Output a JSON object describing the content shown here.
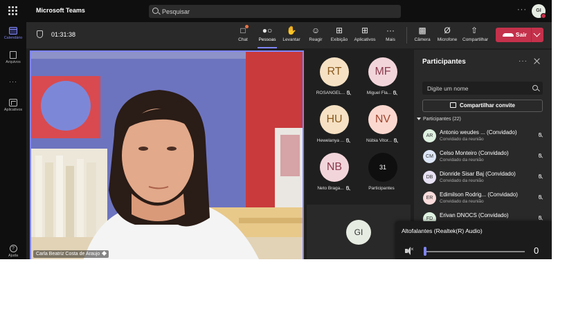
{
  "topbar": {
    "app_title": "Microsoft Teams",
    "search_placeholder": "Pesquisar",
    "more": "···",
    "user_initials": "GI"
  },
  "rail": {
    "items": [
      {
        "label": "Calendário",
        "icon": "calendar-icon",
        "active": true
      },
      {
        "label": "Arquivos",
        "icon": "file-icon"
      },
      {
        "label": "Aplicativos",
        "icon": "apps-icon"
      },
      {
        "label": "Ajuda",
        "icon": "help-icon"
      }
    ],
    "more": "···"
  },
  "meeting": {
    "timer": "01:31:38",
    "toolbar": [
      {
        "label": "Chat",
        "icon": "chat-icon"
      },
      {
        "label": "Pessoas",
        "icon": "people-icon",
        "active": true
      },
      {
        "label": "Levantar",
        "icon": "raise-hand-icon"
      },
      {
        "label": "Reagir",
        "icon": "react-icon"
      },
      {
        "label": "Exibição",
        "icon": "view-icon"
      },
      {
        "label": "Aplicativos",
        "icon": "add-apps-icon"
      },
      {
        "label": "Mais",
        "icon": "more-icon"
      },
      {
        "label": "Câmera",
        "icon": "camera-off-icon"
      },
      {
        "label": "Microfone",
        "icon": "mic-off-icon"
      },
      {
        "label": "Compartilhar",
        "icon": "share-icon"
      }
    ],
    "leave_label": "Sair",
    "leave_color": "#c4314b",
    "accent_color": "#7f85f5"
  },
  "main_video": {
    "speaker_name": "Carla Beatriz Costa de Araujo"
  },
  "grid": {
    "tiles": [
      {
        "initials": "RT",
        "name": "ROSANGEL...",
        "bg": "#f6e1c4",
        "fg": "#8a5a1c"
      },
      {
        "initials": "MF",
        "name": "Miguel Fla...",
        "bg": "#f2d5db",
        "fg": "#8b3a4c"
      },
      {
        "initials": "HU",
        "name": "Hewelanya ...",
        "bg": "#f6e1c4",
        "fg": "#8a5a1c"
      },
      {
        "initials": "NV",
        "name": "Núbia Vitor...",
        "bg": "#fbd8cf",
        "fg": "#a0452f"
      },
      {
        "initials": "NB",
        "name": "Neto Braga...",
        "bg": "#f2d5db",
        "fg": "#8b3a4c"
      },
      {
        "initials": "31",
        "name": "Participantes"
      }
    ],
    "self_initials": "GI"
  },
  "panel": {
    "title": "Participantes",
    "more": "···",
    "search_placeholder": "Digite um nome",
    "share_invite": "Compartilhar convite",
    "list_header": "Participantes (22)",
    "participants": [
      {
        "initials": "AR",
        "name": "Antonio weudes ... (Convidado)",
        "role": "Convidado da reunião",
        "bg": "#dff2e1"
      },
      {
        "initials": "CM",
        "name": "Celso Monteiro (Convidado)",
        "role": "Convidado da reunião",
        "bg": "#dde6f6"
      },
      {
        "initials": "DB",
        "name": "Dionride Sisar Baj (Convidado)",
        "role": "Convidado da reunião",
        "bg": "#e7e1f3"
      },
      {
        "initials": "ER",
        "name": "Edimilson Rodrig... (Convidado)",
        "role": "Convidado da reunião",
        "bg": "#fbdcdc"
      },
      {
        "initials": "FD",
        "name": "Erivan DNOCS (Convidado)",
        "role": "",
        "bg": "#dff2e1"
      }
    ]
  },
  "audio": {
    "device": "Altofalantes (Realtek(R) Audio)",
    "volume": 0
  }
}
